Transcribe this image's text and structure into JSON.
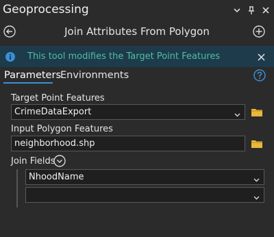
{
  "header": {
    "app_title": "Geoprocessing",
    "tool_title": "Join Attributes From Polygon"
  },
  "info": {
    "message": "This tool modifies the Target Point Features"
  },
  "tabs": [
    {
      "label": "Parameters",
      "active": true
    },
    {
      "label": "Environments",
      "active": false
    }
  ],
  "fields": {
    "target_point_features": {
      "label": "Target Point Features",
      "value": "CrimeDataExport"
    },
    "input_polygon_features": {
      "label": "Input Polygon Features",
      "value": "neighborhood.shp"
    },
    "join_fields": {
      "label": "Join Fields",
      "items": [
        "NhoodName",
        ""
      ]
    }
  },
  "colors": {
    "background": "#2b2b2b",
    "info_bar": "#1d3b4b",
    "info_text": "#4fbfa2",
    "accent": "#3a8fd8",
    "folder": "#e8b93a"
  },
  "icons": {
    "back": "back-arrow-circle-icon",
    "add": "add-circle-icon",
    "info": "info-icon",
    "help": "help-icon",
    "folder": "folder-icon"
  }
}
